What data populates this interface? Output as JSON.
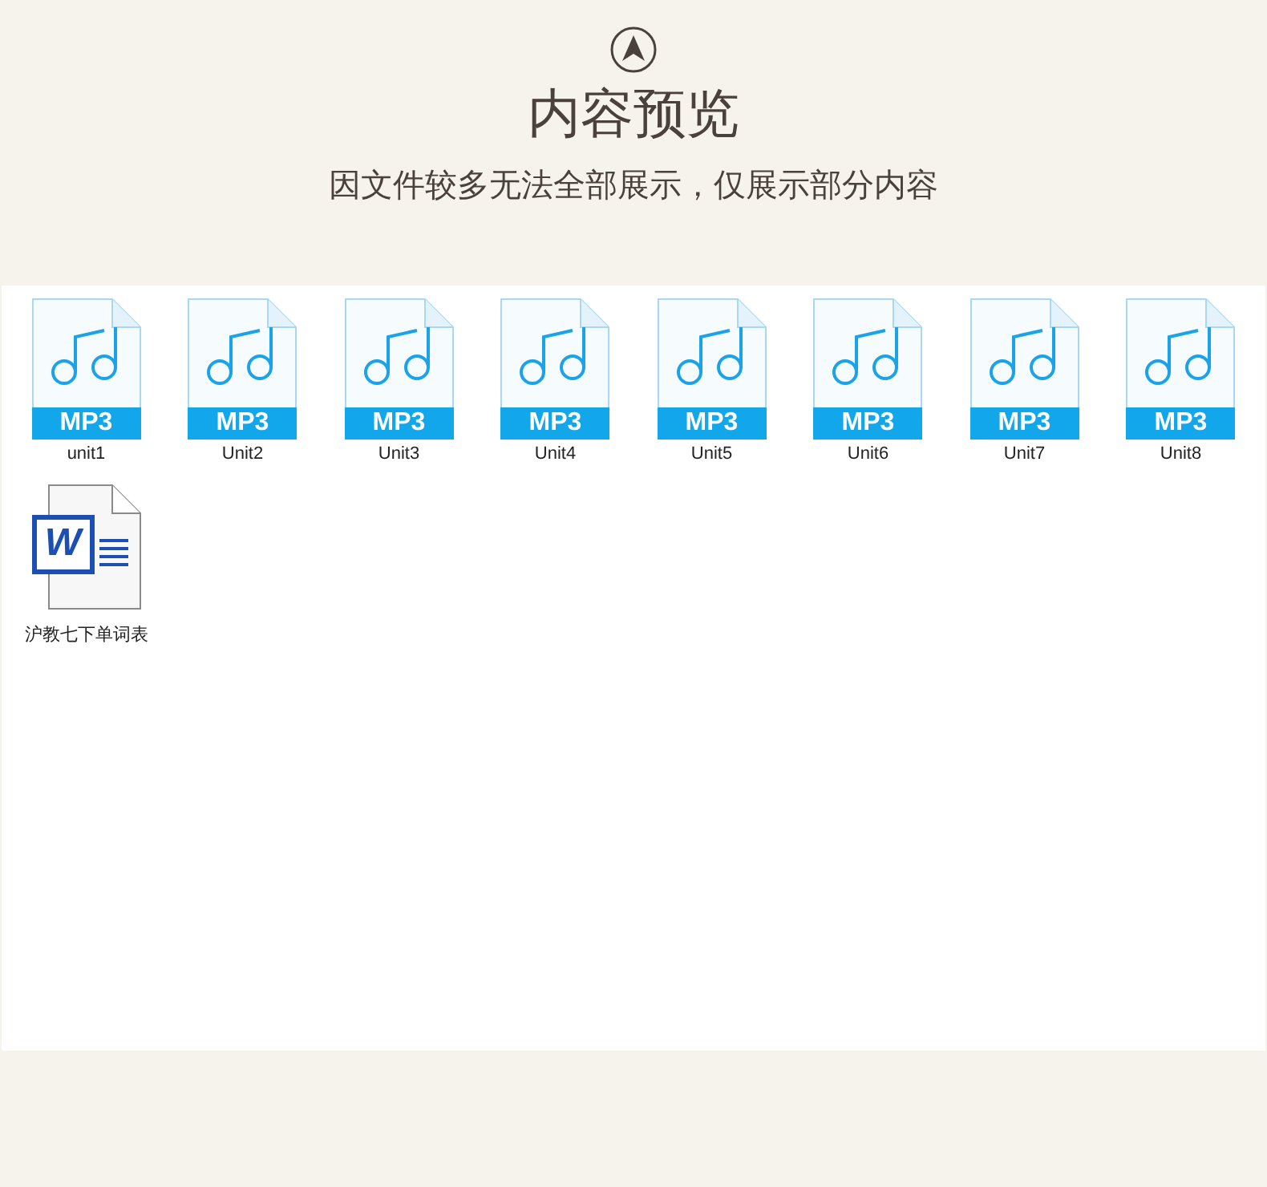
{
  "header": {
    "title": "内容预览",
    "subtitle": "因文件较多无法全部展示，仅展示部分内容"
  },
  "files": [
    {
      "kind": "mp3",
      "badge": "MP3",
      "name": "unit1"
    },
    {
      "kind": "mp3",
      "badge": "MP3",
      "name": "Unit2"
    },
    {
      "kind": "mp3",
      "badge": "MP3",
      "name": "Unit3"
    },
    {
      "kind": "mp3",
      "badge": "MP3",
      "name": "Unit4"
    },
    {
      "kind": "mp3",
      "badge": "MP3",
      "name": "Unit5"
    },
    {
      "kind": "mp3",
      "badge": "MP3",
      "name": "Unit6"
    },
    {
      "kind": "mp3",
      "badge": "MP3",
      "name": "Unit7"
    },
    {
      "kind": "mp3",
      "badge": "MP3",
      "name": "Unit8"
    },
    {
      "kind": "word",
      "badge": "W",
      "name": "沪教七下单词表"
    }
  ]
}
